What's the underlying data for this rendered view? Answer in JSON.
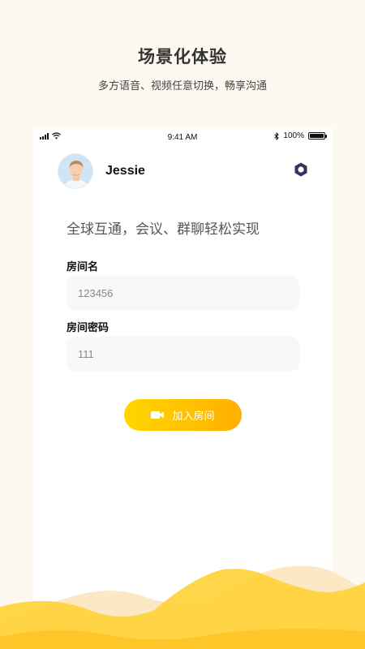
{
  "promo": {
    "title": "场景化体验",
    "subtitle": "多方语音、视频任意切换，畅享沟通"
  },
  "status_bar": {
    "time": "9:41 AM",
    "battery": "100%",
    "battery_level": 1.0
  },
  "profile": {
    "name": "Jessie"
  },
  "main": {
    "tagline": "全球互通，会议、群聊轻松实现",
    "room_name_label": "房间名",
    "room_name_value": "123456",
    "room_password_label": "房间密码",
    "room_password_value": "111",
    "join_button_label": "加入房间"
  },
  "icons": {
    "settings": "settings-hexagon-icon",
    "video": "video-camera-icon",
    "signal": "signal-icon",
    "wifi": "wifi-icon",
    "bluetooth": "bluetooth-icon",
    "battery": "battery-icon"
  },
  "colors": {
    "background": "#fdf8f0",
    "accent_start": "#ffd600",
    "accent_end": "#ffb000",
    "settings_icon": "#33365a",
    "wave_light": "#fde7c2",
    "wave_mid": "#ffd84a",
    "wave_dark": "#ffbe1a"
  }
}
